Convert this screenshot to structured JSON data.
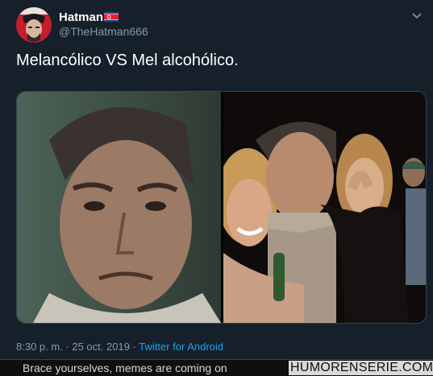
{
  "tweet": {
    "author": {
      "display_name": "Hatman",
      "flag_icon": "north-korea-flag-icon",
      "handle": "@TheHatman666"
    },
    "more_icon": "chevron-down-icon",
    "text": "Melancólico VS Mel alcohólico.",
    "media": {
      "left_image": "photo-sad-man-closeup",
      "right_image": "photo-party-man-with-two-women"
    },
    "timestamp": "8:30 p. m. · 25 oct. 2019 ·",
    "source": "Twitter for Android"
  },
  "watermark": {
    "text": "Brace yourselves, memes are coming on",
    "site": "HUMORENSERIE.COM"
  },
  "colors": {
    "background": "#15202b",
    "secondary_text": "#8899a6",
    "link": "#1da1f2",
    "border": "#38444d"
  }
}
